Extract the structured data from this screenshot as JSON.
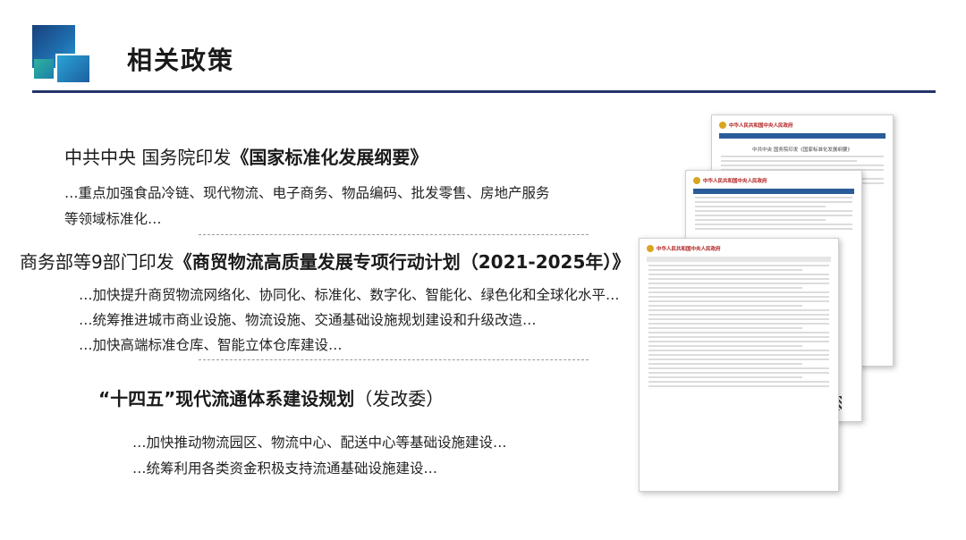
{
  "header": {
    "title": "相关政策"
  },
  "section1": {
    "heading_prefix": "中共中央 国务院印发",
    "heading_doc": "《国家标准化发展纲要》",
    "lines": [
      "…重点加强食品冷链、现代物流、电子商务、物品编码、批发零售、房地产服务",
      "等领域标准化…"
    ]
  },
  "section2": {
    "heading_prefix": "商务部等9部门印发",
    "heading_doc": "《商贸物流高质量发展专项行动计划（2021-2025年）》",
    "lines": [
      "…加快提升商贸物流网络化、协同化、标准化、数字化、智能化、绿色化和全球化水平…",
      "…统筹推进城市商业设施、物流设施、交通基础设施规划建设和升级改造…",
      "…加快高端标准仓库、智能立体仓库建设…"
    ]
  },
  "section3": {
    "heading_doc": "“十四五”现代流通体系建设规划",
    "heading_suffix": "（发改委）",
    "lines": [
      "…加快推动物流园区、物流中心、配送中心等基础设施建设…",
      "…统筹利用各类资金积极支持流通基础设施建设…"
    ]
  },
  "docs": {
    "site_name": "中华人民共和国中央人民政府",
    "doc_title": "中共中央 国务院印发《国家标准化发展纲要》"
  }
}
